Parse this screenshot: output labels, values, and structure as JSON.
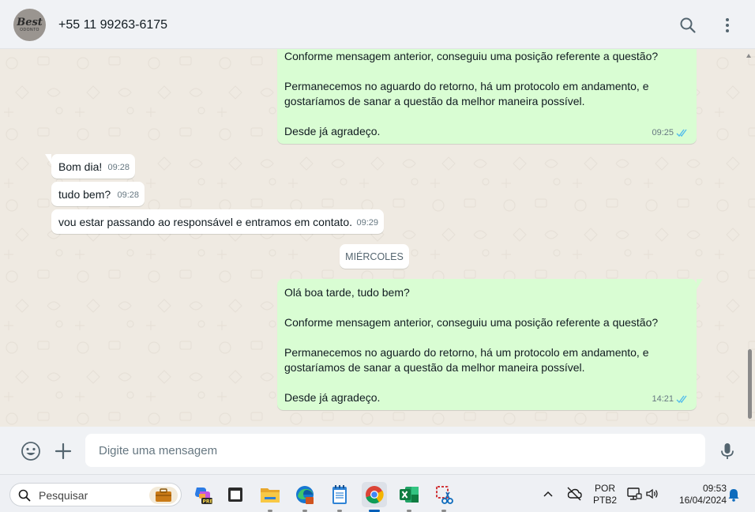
{
  "header": {
    "avatar_logo_top": "Best",
    "avatar_logo_bottom": "ODONTO",
    "contact_name": "+55 11 99263-6175",
    "icons": [
      "search-icon",
      "more-vert-icon"
    ]
  },
  "messages": [
    {
      "direction": "out",
      "lines": [
        "Conforme mensagem anterior, conseguiu uma posição referente a questão?",
        "",
        "Permanecemos no aguardo do retorno, há um protocolo em andamento, e",
        "gostaríamos de sanar a questão da melhor maneira possível.",
        "",
        "Desde já agradeço."
      ],
      "time": "09:25",
      "status": "read"
    },
    {
      "direction": "in",
      "text": "Bom dia!",
      "time": "09:28"
    },
    {
      "direction": "in",
      "text": "tudo bem?",
      "time": "09:28"
    },
    {
      "direction": "in",
      "text": "vou estar passando ao responsável e entramos em contato.",
      "time": "09:29"
    },
    {
      "direction": "out",
      "lines": [
        "Olá boa tarde, tudo bem?",
        "",
        "Conforme mensagem anterior, conseguiu uma posição referente a questão?",
        "",
        "Permanecemos no aguardo do retorno, há um protocolo em andamento, e",
        "gostaríamos de sanar a questão da melhor maneira possível.",
        "",
        "Desde já agradeço."
      ],
      "time": "14:21",
      "status": "read"
    }
  ],
  "date_separator": "MIÉRCOLES",
  "composer": {
    "placeholder": "Digite uma mensagem",
    "icons": [
      "emoji-icon",
      "attach-plus-icon",
      "microphone-icon"
    ]
  },
  "taskbar": {
    "search_label": "Pesquisar",
    "apps": [
      "work-briefcase-icon",
      "copilot-pre-icon",
      "window-app-icon",
      "file-explorer-icon",
      "edge-browser-icon",
      "notepad-icon",
      "chrome-icon",
      "excel-icon",
      "snipping-tool-icon"
    ],
    "tray": {
      "language": "POR",
      "layout": "PTB2",
      "time": "09:53",
      "date": "16/04/2024"
    }
  },
  "colors": {
    "outgoing_bubble": "#d9fdd3",
    "incoming_bubble": "#ffffff",
    "chat_background": "#efeae2",
    "read_ticks": "#53bdeb"
  }
}
